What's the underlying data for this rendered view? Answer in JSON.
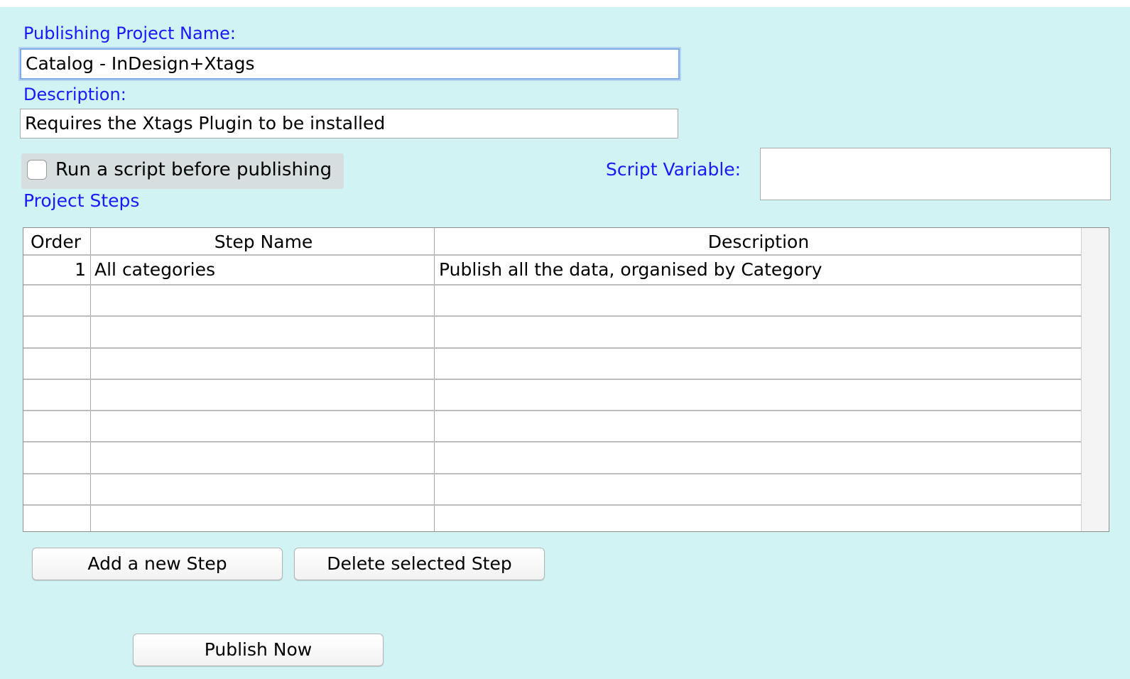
{
  "project": {
    "name_label": "Publishing Project Name:",
    "name_value": "Catalog - InDesign+Xtags",
    "description_label": "Description:",
    "description_value": "Requires the Xtags Plugin to be installed"
  },
  "script": {
    "run_label": "Run a script before publishing",
    "run_checked": false,
    "variable_label": "Script Variable:",
    "variable_value": ""
  },
  "steps": {
    "section_label": "Project Steps",
    "columns": [
      "Order",
      "Step Name",
      "Description"
    ],
    "rows": [
      {
        "order": "1",
        "name": "All categories",
        "description": "Publish all the data, organised by Category"
      }
    ]
  },
  "buttons": {
    "add_step": "Add a new Step",
    "delete_step": "Delete selected Step",
    "publish_now": "Publish Now"
  },
  "colors": {
    "background": "#d1f3f4",
    "label": "#1a1aff"
  }
}
